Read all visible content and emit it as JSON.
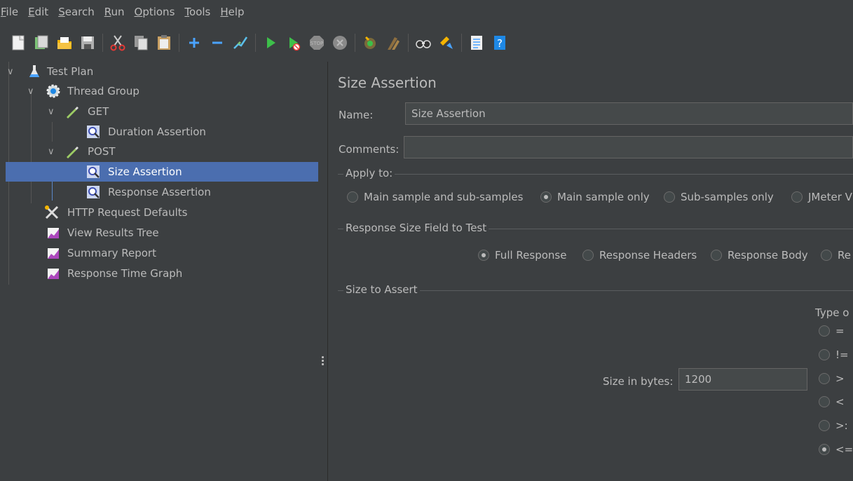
{
  "menu": [
    {
      "mn": "F",
      "rest": "ile"
    },
    {
      "mn": "E",
      "rest": "dit"
    },
    {
      "mn": "S",
      "rest": "earch"
    },
    {
      "mn": "R",
      "rest": "un"
    },
    {
      "mn": "O",
      "rest": "ptions"
    },
    {
      "mn": "T",
      "rest": "ools"
    },
    {
      "mn": "H",
      "rest": "elp"
    }
  ],
  "toolbar_icons": [
    "new-icon",
    "templates-icon",
    "open-icon",
    "save-icon",
    "cut-icon",
    "copy-icon",
    "paste-icon",
    "expand-icon",
    "collapse-icon",
    "toggle-icon",
    "start-icon",
    "start-no-pauses-icon",
    "stop-icon",
    "shutdown-icon",
    "clear-icon",
    "clear-all-icon",
    "search-icon",
    "reset-search-icon",
    "function-helper-icon",
    "help-icon"
  ],
  "tree": {
    "items": [
      {
        "label": "Test Plan",
        "icon": "flask-icon"
      },
      {
        "label": "Thread Group",
        "icon": "gear-icon"
      },
      {
        "label": "GET",
        "icon": "pipette-icon"
      },
      {
        "label": "Duration Assertion",
        "icon": "magnifier-icon"
      },
      {
        "label": "POST",
        "icon": "pipette-icon"
      },
      {
        "label": "Size Assertion",
        "icon": "magnifier-icon"
      },
      {
        "label": "Response Assertion",
        "icon": "magnifier-icon"
      },
      {
        "label": "HTTP Request Defaults",
        "icon": "tools-icon"
      },
      {
        "label": "View Results Tree",
        "icon": "graph-icon"
      },
      {
        "label": "Summary Report",
        "icon": "graph-icon"
      },
      {
        "label": "Response Time Graph",
        "icon": "graph-icon"
      }
    ],
    "selected": "Size Assertion"
  },
  "panel": {
    "title": "Size Assertion",
    "name_label": "Name:",
    "name_value": "Size Assertion",
    "comments_label": "Comments:",
    "comments_value": "",
    "apply_to": {
      "title": "Apply to:",
      "options": [
        "Main sample and sub-samples",
        "Main sample only",
        "Sub-samples only",
        "JMeter V"
      ],
      "selected": "Main sample only"
    },
    "field_to_test": {
      "title": "Response Size Field to Test",
      "options": [
        "Full Response",
        "Response Headers",
        "Response Body",
        "Re"
      ],
      "selected": "Full Response"
    },
    "size_to_assert": {
      "title": "Size to Assert",
      "size_label": "Size in bytes:",
      "size_value": "1200",
      "type_label": "Type o",
      "operators": [
        "=",
        "!=",
        ">",
        "<",
        ">:",
        "<="
      ],
      "selected_operator": "<="
    }
  },
  "colors": {
    "background": "#3c3f41",
    "selection": "#4b6eaf",
    "text": "#bbbbbb",
    "field": "#45494a"
  }
}
